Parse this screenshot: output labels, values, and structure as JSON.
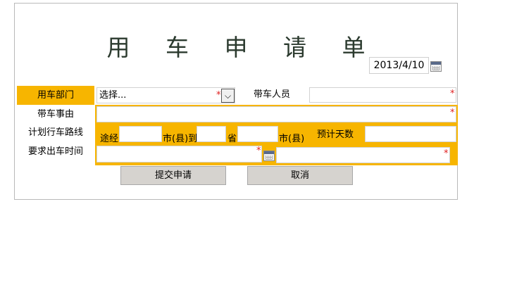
{
  "form": {
    "title": "用 车 申 请 单",
    "date": "2013/4/10",
    "dept_label": "用车部门",
    "dept_select_value": "选择...",
    "escort_label": "带车人员",
    "reason_label": "带车事由",
    "route_label": "计划行车路线",
    "route_via": "途经",
    "route_city_to": "市(县)到",
    "route_province": "省",
    "route_city": "市(县)",
    "days_label": "预计天数",
    "time_label": "要求出车时间",
    "required_mark": "*",
    "submit_label": "提交申请",
    "cancel_label": "取消"
  },
  "icons": {
    "calendar": "calendar-icon",
    "dropdown": "chevron-down-icon"
  },
  "colors": {
    "accent": "#f7b500",
    "required": "#e02020",
    "button_bg": "#d6d3cf"
  }
}
